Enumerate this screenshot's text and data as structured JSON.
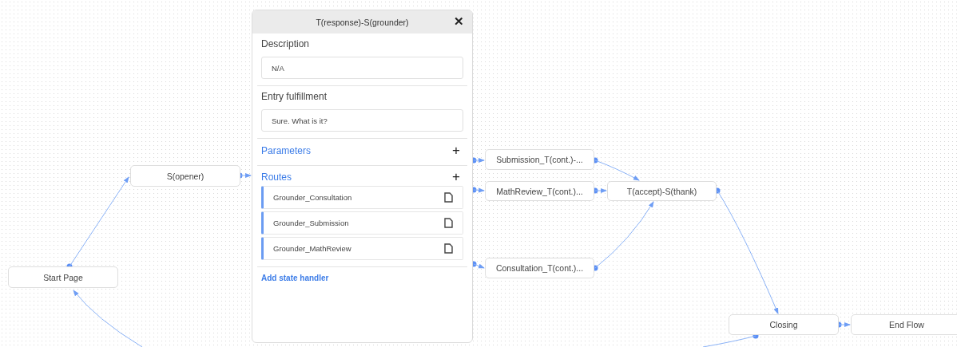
{
  "nodes": [
    {
      "label": "Start Page"
    },
    {
      "label": "S(opener)"
    },
    {
      "label": "Submission_T(cont.)-..."
    },
    {
      "label": "MathReview_T(cont.)..."
    },
    {
      "label": "T(accept)-S(thank)"
    },
    {
      "label": "Consultation_T(cont.)..."
    },
    {
      "label": "Closing"
    },
    {
      "label": "End Flow"
    }
  ],
  "panel": {
    "title": "T(response)-S(grounder)",
    "close": "✕",
    "description": {
      "label": "Description",
      "value": "N/A"
    },
    "entry_fulfillment": {
      "label": "Entry fulfillment",
      "value": "Sure. What is it?"
    },
    "parameters": {
      "label": "Parameters",
      "add": "+"
    },
    "routes": {
      "label": "Routes",
      "add": "+",
      "items": [
        "Grounder_Consultation",
        "Grounder_Submission",
        "Grounder_MathReview"
      ]
    },
    "add_state_handler": "Add state handler"
  }
}
